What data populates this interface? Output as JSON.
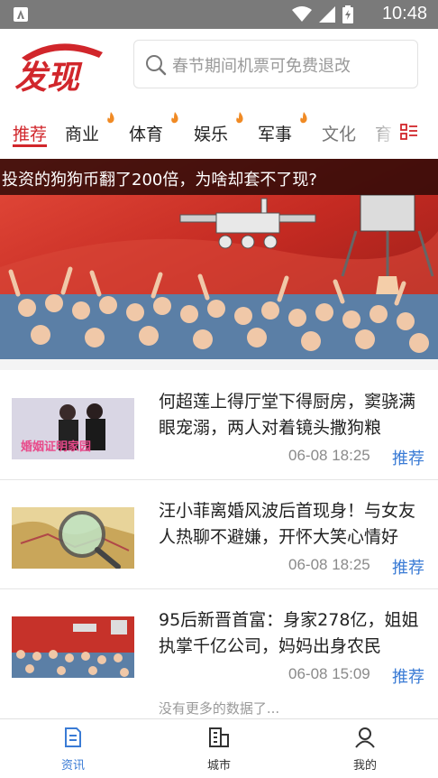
{
  "status_bar": {
    "time": "10:48"
  },
  "header": {
    "logo_text": "发现",
    "search_placeholder": "春节期间机票可免费退改"
  },
  "tabs": [
    {
      "label": "推荐",
      "active": true,
      "hot": false
    },
    {
      "label": "商业",
      "active": false,
      "hot": true
    },
    {
      "label": "体育",
      "active": false,
      "hot": true
    },
    {
      "label": "娱乐",
      "active": false,
      "hot": true
    },
    {
      "label": "军事",
      "active": false,
      "hot": true
    },
    {
      "label": "文化",
      "active": false,
      "hot": false
    },
    {
      "label": "育",
      "active": false,
      "hot": false
    }
  ],
  "banner": {
    "title": "投资的狗狗币翻了200倍，为啥却套不了现?"
  },
  "news": [
    {
      "title": "何超莲上得厅堂下得厨房，窦骁满眼宠溺，两人对着镜头撒狗粮",
      "time": "06-08 18:25",
      "tag": "推荐",
      "thumb_caption": "婚姻证明家园"
    },
    {
      "title": "汪小菲离婚风波后首现身！与女友人热聊不避嫌，开怀大笑心情好",
      "time": "06-08 18:25",
      "tag": "推荐"
    },
    {
      "title": "95后新晋首富：身家278亿，姐姐执掌千亿公司，妈妈出身农民",
      "time": "06-08 15:09",
      "tag": "推荐"
    }
  ],
  "footer_text": "没有更多的数据了...",
  "bottom_nav": [
    {
      "label": "资讯",
      "icon": "news-icon",
      "active": true
    },
    {
      "label": "城市",
      "icon": "city-icon",
      "active": false
    },
    {
      "label": "我的",
      "icon": "profile-icon",
      "active": false
    }
  ],
  "colors": {
    "accent_red": "#d1262b",
    "link_blue": "#3a7bd5",
    "status_bar": "#7a7a7a"
  }
}
